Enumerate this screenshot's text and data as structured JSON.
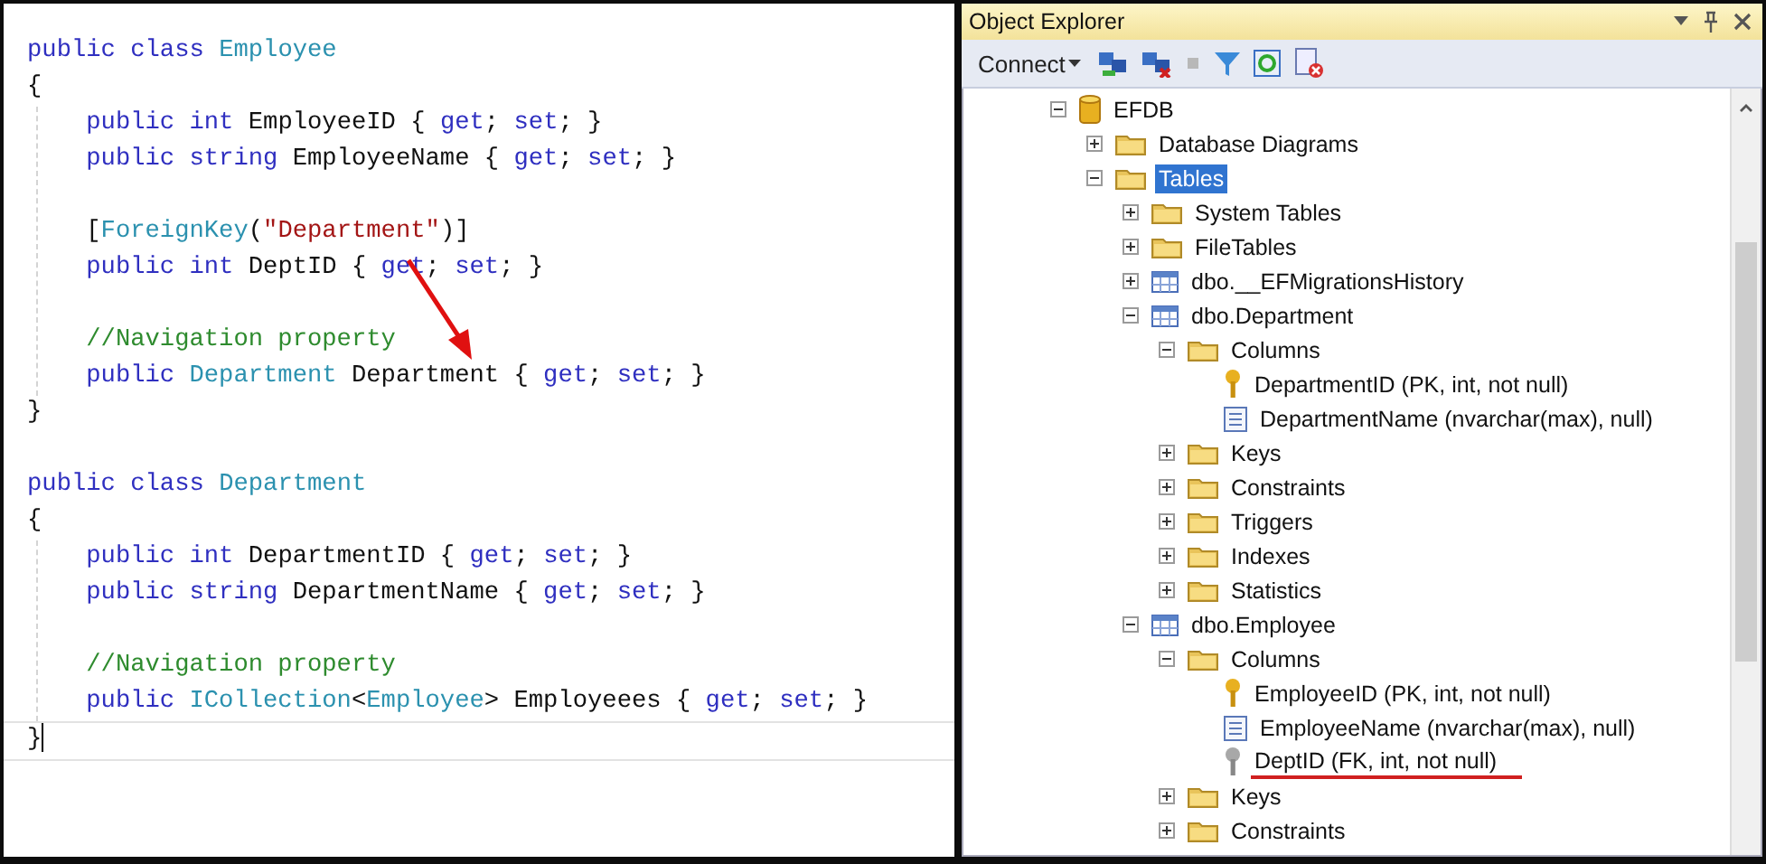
{
  "code_editor": {
    "lines": [
      {
        "current": false,
        "tokens": [
          {
            "kind": "kw",
            "text": "public class "
          },
          {
            "kind": "type",
            "text": "Employee"
          }
        ]
      },
      {
        "current": false,
        "tokens": [
          {
            "kind": "plain",
            "text": "{"
          }
        ]
      },
      {
        "current": false,
        "tokens": [
          {
            "kind": "kw",
            "text": "    public int "
          },
          {
            "kind": "plain",
            "text": "EmployeeID { "
          },
          {
            "kind": "kw",
            "text": "get"
          },
          {
            "kind": "plain",
            "text": "; "
          },
          {
            "kind": "kw",
            "text": "set"
          },
          {
            "kind": "plain",
            "text": "; }"
          }
        ]
      },
      {
        "current": false,
        "tokens": [
          {
            "kind": "kw",
            "text": "    public string "
          },
          {
            "kind": "plain",
            "text": "EmployeeName { "
          },
          {
            "kind": "kw",
            "text": "get"
          },
          {
            "kind": "plain",
            "text": "; "
          },
          {
            "kind": "kw",
            "text": "set"
          },
          {
            "kind": "plain",
            "text": "; }"
          }
        ]
      },
      {
        "current": false
      },
      {
        "current": false,
        "tokens": [
          {
            "kind": "plain",
            "text": "    ["
          },
          {
            "kind": "type",
            "text": "ForeignKey"
          },
          {
            "kind": "plain",
            "text": "("
          },
          {
            "kind": "string",
            "text": "\"Department\""
          },
          {
            "kind": "plain",
            "text": ")]"
          }
        ]
      },
      {
        "current": false,
        "tokens": [
          {
            "kind": "kw",
            "text": "    public int "
          },
          {
            "kind": "plain",
            "text": "DeptID { "
          },
          {
            "kind": "kw",
            "text": "get"
          },
          {
            "kind": "plain",
            "text": "; "
          },
          {
            "kind": "kw",
            "text": "set"
          },
          {
            "kind": "plain",
            "text": "; }"
          }
        ]
      },
      {
        "current": false
      },
      {
        "current": false,
        "tokens": [
          {
            "kind": "comment",
            "text": "    //Navigation property"
          }
        ]
      },
      {
        "current": false,
        "tokens": [
          {
            "kind": "kw",
            "text": "    public "
          },
          {
            "kind": "type",
            "text": "Department"
          },
          {
            "kind": "plain",
            "text": " Department { "
          },
          {
            "kind": "kw",
            "text": "get"
          },
          {
            "kind": "plain",
            "text": "; "
          },
          {
            "kind": "kw",
            "text": "set"
          },
          {
            "kind": "plain",
            "text": "; }"
          }
        ]
      },
      {
        "current": false,
        "tokens": [
          {
            "kind": "plain",
            "text": "}"
          }
        ]
      },
      {
        "current": false
      },
      {
        "current": false,
        "tokens": [
          {
            "kind": "kw",
            "text": "public class "
          },
          {
            "kind": "type",
            "text": "Department"
          }
        ]
      },
      {
        "current": false,
        "tokens": [
          {
            "kind": "plain",
            "text": "{"
          }
        ]
      },
      {
        "current": false,
        "tokens": [
          {
            "kind": "kw",
            "text": "    public int "
          },
          {
            "kind": "plain",
            "text": "DepartmentID { "
          },
          {
            "kind": "kw",
            "text": "get"
          },
          {
            "kind": "plain",
            "text": "; "
          },
          {
            "kind": "kw",
            "text": "set"
          },
          {
            "kind": "plain",
            "text": "; }"
          }
        ]
      },
      {
        "current": false,
        "tokens": [
          {
            "kind": "kw",
            "text": "    public string "
          },
          {
            "kind": "plain",
            "text": "DepartmentName { "
          },
          {
            "kind": "kw",
            "text": "get"
          },
          {
            "kind": "plain",
            "text": "; "
          },
          {
            "kind": "kw",
            "text": "set"
          },
          {
            "kind": "plain",
            "text": "; }"
          }
        ]
      },
      {
        "current": false
      },
      {
        "current": false,
        "tokens": [
          {
            "kind": "comment",
            "text": "    //Navigation property"
          }
        ]
      },
      {
        "current": false,
        "tokens": [
          {
            "kind": "kw",
            "text": "    public "
          },
          {
            "kind": "type",
            "text": "ICollection"
          },
          {
            "kind": "plain",
            "text": "<"
          },
          {
            "kind": "type",
            "text": "Employee"
          },
          {
            "kind": "plain",
            "text": "> Employeees { "
          },
          {
            "kind": "kw",
            "text": "get"
          },
          {
            "kind": "plain",
            "text": "; "
          },
          {
            "kind": "kw",
            "text": "set"
          },
          {
            "kind": "plain",
            "text": "; }"
          }
        ]
      },
      {
        "current": true,
        "tokens": [
          {
            "kind": "plain",
            "text": "}"
          }
        ]
      }
    ]
  },
  "object_explorer": {
    "title": "Object Explorer",
    "connect_button": "Connect",
    "tree": [
      {
        "label": "EFDB",
        "kind": "database",
        "expanded": true,
        "selected": false,
        "underlined": false,
        "children": [
          {
            "label": "Database Diagrams",
            "kind": "folder",
            "expanded": false,
            "selected": false,
            "underlined": false
          },
          {
            "label": "Tables",
            "kind": "folder",
            "expanded": true,
            "selected": true,
            "underlined": false,
            "children": [
              {
                "label": "System Tables",
                "kind": "folder",
                "expanded": false,
                "selected": false,
                "underlined": false
              },
              {
                "label": "FileTables",
                "kind": "folder",
                "expanded": false,
                "selected": false,
                "underlined": false
              },
              {
                "label": "dbo.__EFMigrationsHistory",
                "kind": "table",
                "expanded": false,
                "selected": false,
                "underlined": false
              },
              {
                "label": "dbo.Department",
                "kind": "table",
                "expanded": true,
                "selected": false,
                "underlined": false,
                "children": [
                  {
                    "label": "Columns",
                    "kind": "folder",
                    "expanded": true,
                    "selected": false,
                    "underlined": false,
                    "children": [
                      {
                        "label": "DepartmentID (PK, int, not null)",
                        "kind": "primary-key",
                        "selected": false,
                        "underlined": false
                      },
                      {
                        "label": "DepartmentName (nvarchar(max), null)",
                        "kind": "column",
                        "selected": false,
                        "underlined": false
                      }
                    ]
                  },
                  {
                    "label": "Keys",
                    "kind": "folder",
                    "expanded": false,
                    "selected": false,
                    "underlined": false
                  },
                  {
                    "label": "Constraints",
                    "kind": "folder",
                    "expanded": false,
                    "selected": false,
                    "underlined": false
                  },
                  {
                    "label": "Triggers",
                    "kind": "folder",
                    "expanded": false,
                    "selected": false,
                    "underlined": false
                  },
                  {
                    "label": "Indexes",
                    "kind": "folder",
                    "expanded": false,
                    "selected": false,
                    "underlined": false
                  },
                  {
                    "label": "Statistics",
                    "kind": "folder",
                    "expanded": false,
                    "selected": false,
                    "underlined": false
                  }
                ]
              },
              {
                "label": "dbo.Employee",
                "kind": "table",
                "expanded": true,
                "selected": false,
                "underlined": false,
                "children": [
                  {
                    "label": "Columns",
                    "kind": "folder",
                    "expanded": true,
                    "selected": false,
                    "underlined": false,
                    "children": [
                      {
                        "label": "EmployeeID (PK, int, not null)",
                        "kind": "primary-key",
                        "selected": false,
                        "underlined": false
                      },
                      {
                        "label": "EmployeeName (nvarchar(max), null)",
                        "kind": "column",
                        "selected": false,
                        "underlined": false
                      },
                      {
                        "label": "DeptID (FK, int, not null)",
                        "kind": "foreign-key",
                        "selected": false,
                        "underlined": true
                      }
                    ]
                  },
                  {
                    "label": "Keys",
                    "kind": "folder",
                    "expanded": false,
                    "selected": false,
                    "underlined": false
                  },
                  {
                    "label": "Constraints",
                    "kind": "folder",
                    "expanded": false,
                    "selected": false,
                    "underlined": false
                  }
                ]
              }
            ]
          }
        ]
      }
    ]
  }
}
